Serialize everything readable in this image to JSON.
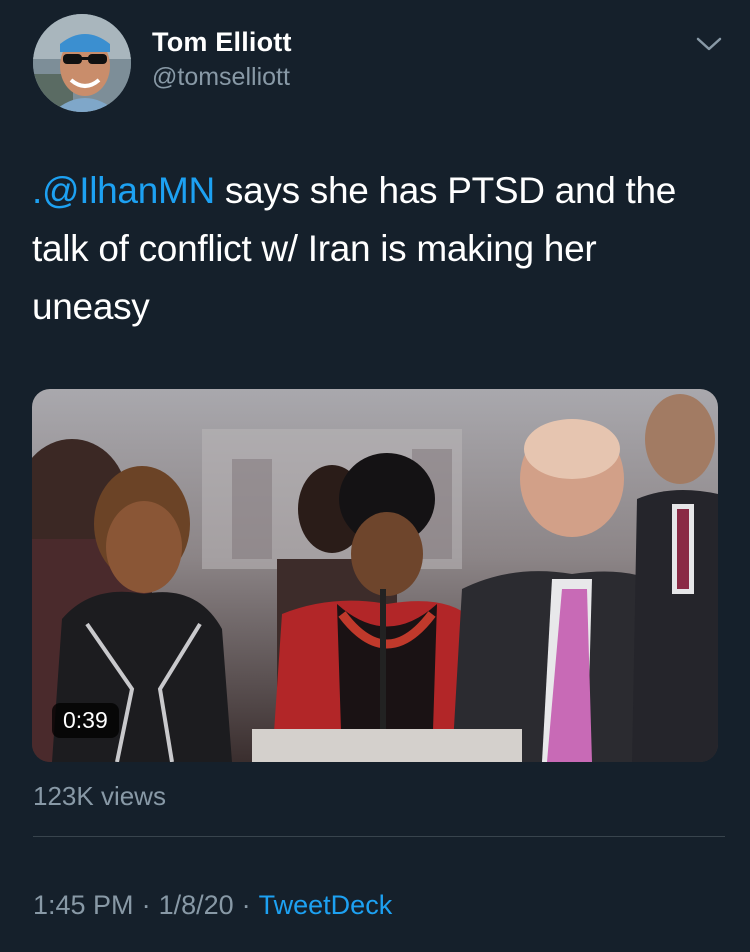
{
  "colors": {
    "background": "#15202b",
    "primary_text": "#ffffff",
    "secondary_text": "#8899a6",
    "link": "#1da1f2",
    "divider": "#38444d"
  },
  "author": {
    "display_name": "Tom Elliott",
    "handle": "@tomselliott",
    "avatar_icon": "user-avatar"
  },
  "menu": {
    "icon": "chevron-down-icon"
  },
  "tweet": {
    "mention": ".@IlhanMN",
    "text_rest": " says she has PTSD and the talk of conflict w/ Iran is making her uneasy"
  },
  "media": {
    "type": "video",
    "duration": "0:39"
  },
  "stats": {
    "views": "123K views"
  },
  "meta": {
    "time": "1:45 PM",
    "date": "1/8/20",
    "separator": "·",
    "source": "TweetDeck"
  }
}
